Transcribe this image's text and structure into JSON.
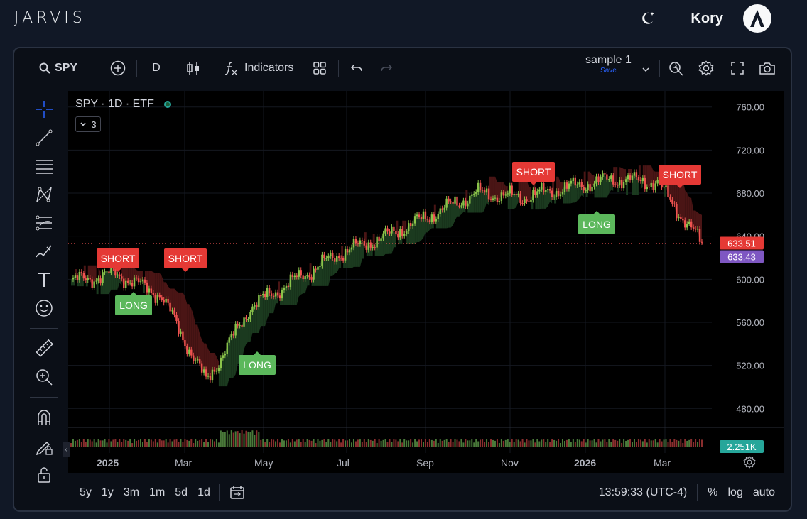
{
  "app": {
    "brand": "JARVIS",
    "user_name": "Kory"
  },
  "toolbar": {
    "symbol": "SPY",
    "interval": "D",
    "indicators_label": "Indicators",
    "layout_name": "sample 1",
    "save_label": "Save"
  },
  "legend": {
    "title": "SPY · 1D · ETF",
    "collapsed_count": "3"
  },
  "price_axis": {
    "ticks": [
      "760.00",
      "720.00",
      "680.00",
      "640.00",
      "600.00",
      "560.00",
      "520.00",
      "480.00"
    ],
    "last_price_badge": "633.51",
    "indicator_badge": "633.43",
    "volume_badge": "2.251K"
  },
  "time_axis": {
    "labels": [
      "2025",
      "Mar",
      "May",
      "Jul",
      "Sep",
      "Nov",
      "2026",
      "Mar"
    ]
  },
  "signals": [
    {
      "label": "SHORT",
      "kind": "short"
    },
    {
      "label": "SHORT",
      "kind": "short"
    },
    {
      "label": "LONG",
      "kind": "long"
    },
    {
      "label": "LONG",
      "kind": "long"
    },
    {
      "label": "SHORT",
      "kind": "short"
    },
    {
      "label": "LONG",
      "kind": "long"
    },
    {
      "label": "SHORT",
      "kind": "short"
    }
  ],
  "bottom_bar": {
    "ranges": [
      "5y",
      "1y",
      "3m",
      "1m",
      "5d",
      "1d"
    ],
    "clock": "13:59:33 (UTC-4)",
    "percent_label": "%",
    "log_label": "log",
    "auto_label": "auto"
  },
  "colors": {
    "up": "#26a69a",
    "down": "#ef5350",
    "short_badge": "#e53935",
    "long_badge": "#5cb85c",
    "indicator_badge": "#7e57c2"
  },
  "chart_data": {
    "type": "line",
    "title": "SPY · 1D · ETF",
    "x": [
      "2025-01",
      "2025-02",
      "2025-03",
      "2025-04",
      "2025-05",
      "2025-06",
      "2025-07",
      "2025-08",
      "2025-09",
      "2025-10",
      "2025-11",
      "2025-12",
      "2026-01",
      "2026-02",
      "2026-03"
    ],
    "series": [
      {
        "values": [
          598,
          605,
          585,
          505,
          575,
          600,
          625,
          640,
          660,
          680,
          676,
          685,
          693,
          690,
          633
        ]
      }
    ],
    "ylim": [
      465,
      775
    ]
  }
}
